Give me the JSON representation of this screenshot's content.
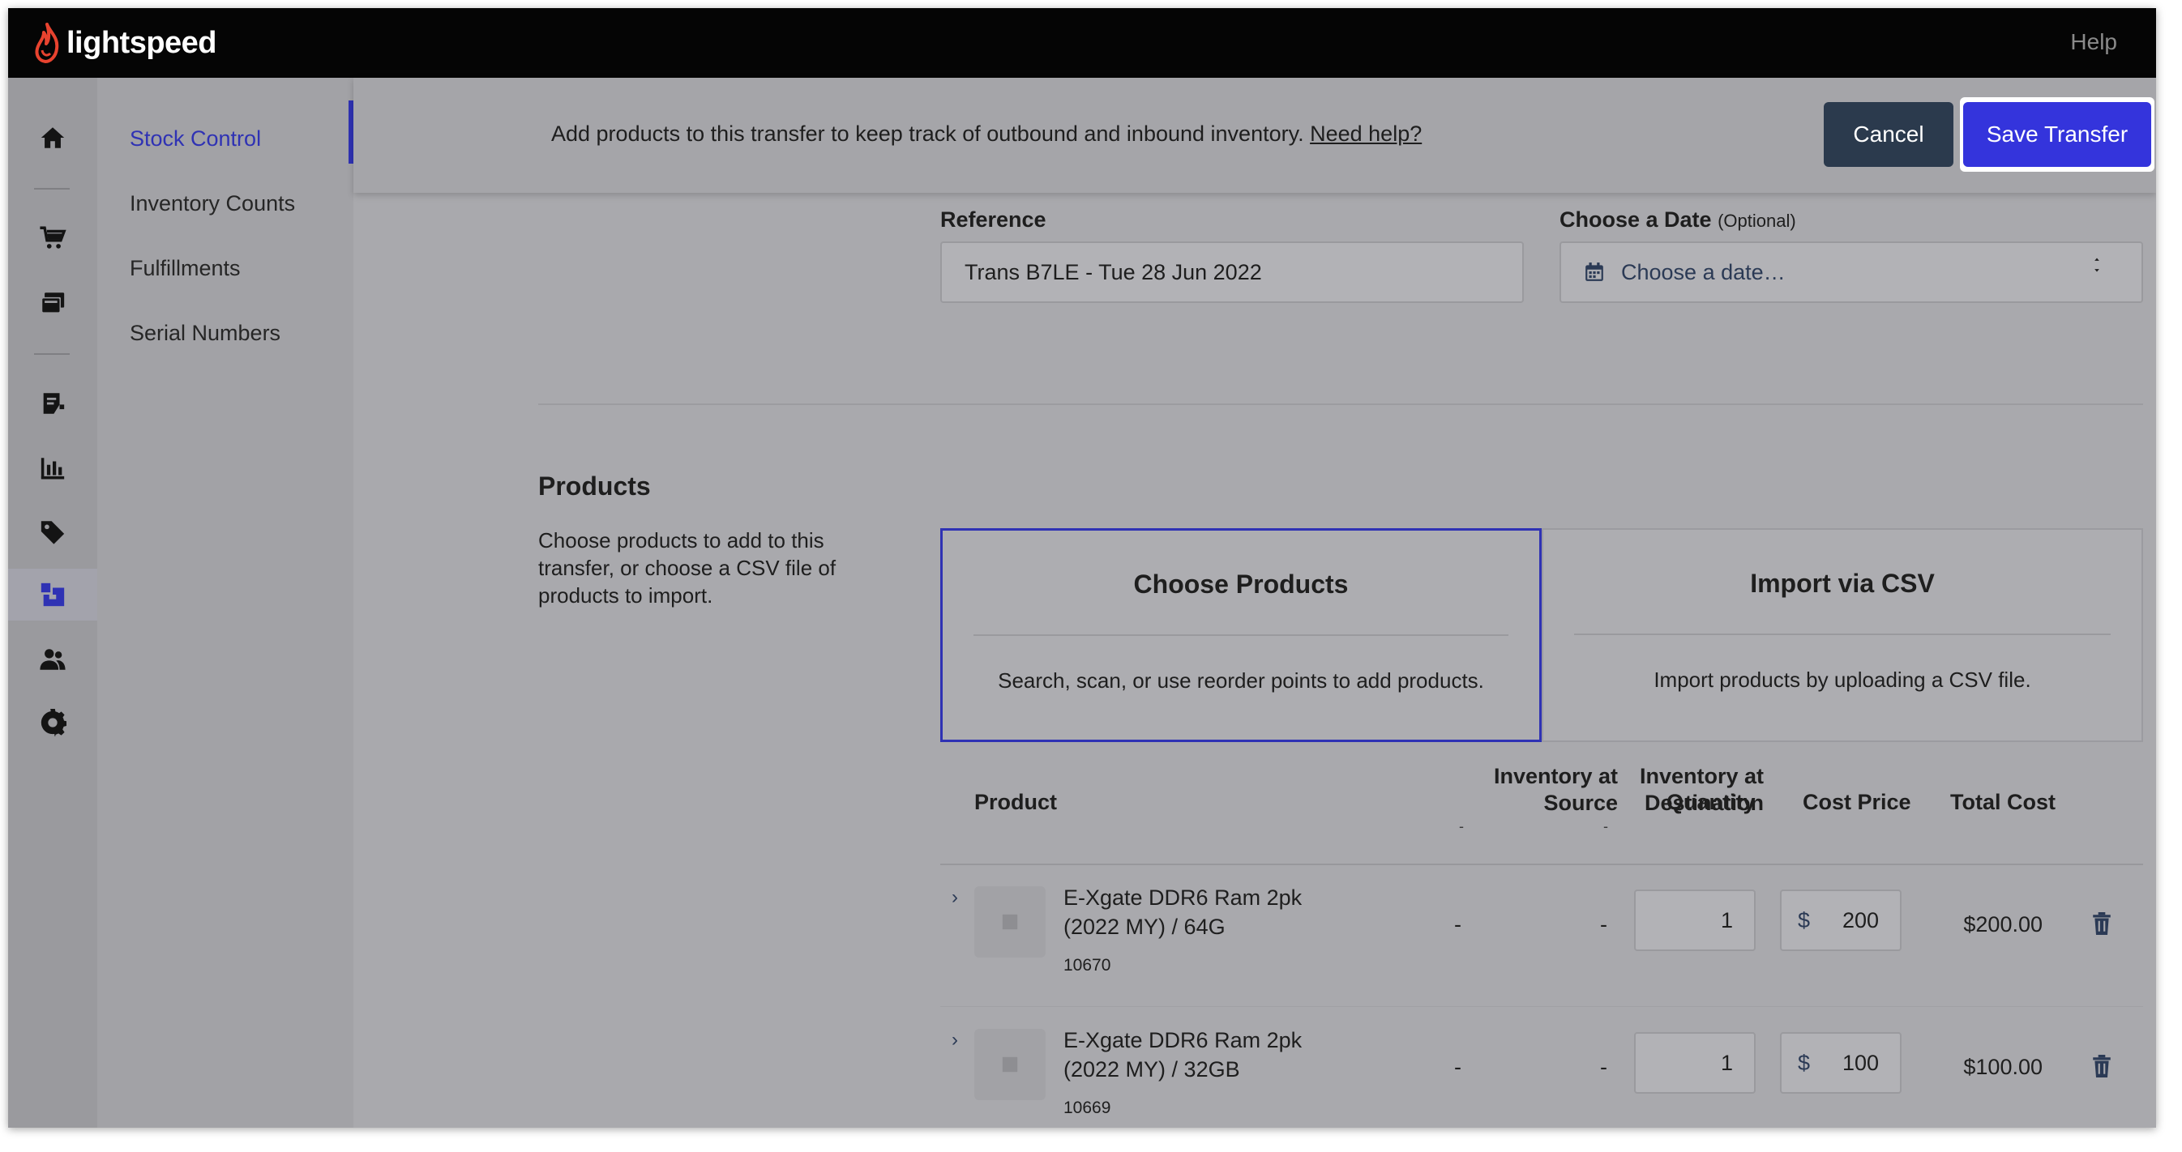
{
  "brand": {
    "logo_text": "lightspeed"
  },
  "topbar": {
    "help_label": "Help"
  },
  "rail": {
    "items": [
      {
        "name": "home-icon"
      },
      {
        "name": "cart-icon"
      },
      {
        "name": "register-icon"
      },
      {
        "name": "invoice-icon"
      },
      {
        "name": "reports-icon"
      },
      {
        "name": "tag-icon"
      },
      {
        "name": "inventory-icon",
        "active": true
      },
      {
        "name": "customers-icon"
      },
      {
        "name": "settings-icon"
      }
    ]
  },
  "subnav": {
    "items": [
      {
        "label": "Stock Control",
        "active": true
      },
      {
        "label": "Inventory Counts"
      },
      {
        "label": "Fulfillments"
      },
      {
        "label": "Serial Numbers"
      }
    ]
  },
  "actionbar": {
    "message": "Add products to this transfer to keep track of outbound and inbound inventory.",
    "help_link": "Need help?",
    "cancel_label": "Cancel",
    "save_label": "Save Transfer"
  },
  "form": {
    "reference_label": "Reference",
    "reference_value": "Trans B7LE - Tue 28 Jun 2022",
    "date_label": "Choose a Date",
    "date_optional": "(Optional)",
    "date_placeholder": "Choose a date…"
  },
  "products": {
    "title": "Products",
    "description": "Choose products to add to this transfer, or choose a CSV file of products to import.",
    "choose_card": {
      "title": "Choose Products",
      "description": "Search, scan, or use reorder points to add products."
    },
    "import_card": {
      "title": "Import via CSV",
      "description": "Import products by uploading a CSV file."
    }
  },
  "table": {
    "headers": {
      "product": "Product",
      "inv_source_line1": "Inventory at",
      "inv_source_line2": "Source",
      "inv_source_sub": "-",
      "inv_dest_line1": "Inventory at",
      "inv_dest_line2": "Destination",
      "inv_dest_sub": "-",
      "quantity": "Quantity",
      "cost_price": "Cost Price",
      "total_cost": "Total Cost"
    },
    "rows": [
      {
        "chevron": "›",
        "name_line1": "E-Xgate DDR6 Ram 2pk",
        "name_line2": "(2022 MY) / 64G",
        "sku": "10670",
        "inv_source": "-",
        "inv_dest": "-",
        "quantity": "1",
        "currency": "$",
        "cost": "200",
        "total": "$200.00"
      },
      {
        "chevron": "›",
        "name_line1": "E-Xgate DDR6 Ram 2pk",
        "name_line2": "(2022 MY) / 32GB",
        "sku": "10669",
        "inv_source": "-",
        "inv_dest": "-",
        "quantity": "1",
        "currency": "$",
        "cost": "100",
        "total": "$100.00"
      }
    ]
  }
}
